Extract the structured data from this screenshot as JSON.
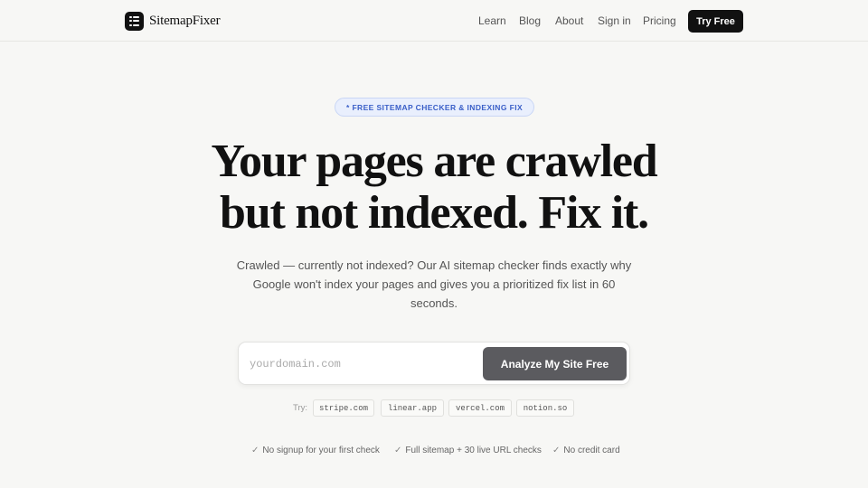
{
  "brand": {
    "name": "SitemapFixer",
    "logo_icon": "list-icon"
  },
  "nav": {
    "links": [
      "Learn",
      "Blog",
      "About",
      "Sign in",
      "Pricing"
    ],
    "cta": "Try Free"
  },
  "hero": {
    "badge": "* FREE SITEMAP CHECKER & INDEXING FIX",
    "headline_line1": "Your pages are crawled",
    "headline_line2": "but not indexed. Fix it.",
    "subtext": "Crawled — currently not indexed? Our AI sitemap checker finds exactly why Google won't index your pages and gives you a prioritized fix list in 60 seconds."
  },
  "search": {
    "placeholder": "yourdomain.com",
    "value": "",
    "button_label": "Analyze My Site Free"
  },
  "examples": {
    "label": "Try:",
    "domains": [
      "stripe.com",
      "linear.app",
      "vercel.com",
      "notion.so"
    ]
  },
  "features": [
    "No signup for your first check",
    "Full sitemap + 30 live URL checks",
    "No credit card"
  ],
  "colors": {
    "background": "#f7f7f5",
    "primary": "#111111",
    "accent": "#3a5fc8",
    "button": "#5b5b5f"
  }
}
